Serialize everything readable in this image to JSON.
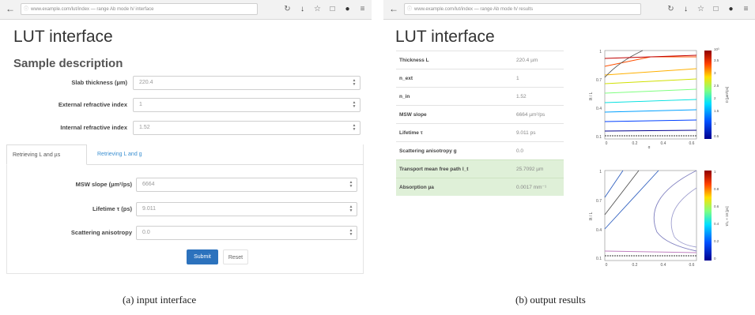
{
  "panel_a": {
    "url_text": "www.example.com/lut/index — range Ab mode h/ interface",
    "title": "LUT interface",
    "section_title": "Sample description",
    "fields": [
      {
        "label": "Slab thickness (µm)",
        "value": "220.4"
      },
      {
        "label": "External refractive index",
        "value": "1"
      },
      {
        "label": "Internal refractive index",
        "value": "1.52"
      }
    ],
    "tabs": [
      {
        "label": "Retrieving L and µs",
        "active": true
      },
      {
        "label": "Retrieving L and g",
        "active": false
      }
    ],
    "tab_fields": [
      {
        "label": "MSW slope (µm²/ps)",
        "value": "6664"
      },
      {
        "label": "Lifetime τ (ps)",
        "value": "9.011"
      },
      {
        "label": "Scattering anisotropy",
        "value": "0.0"
      }
    ],
    "submit_label": "Submit",
    "reset_label": "Reset",
    "caption": "(a) input interface"
  },
  "panel_b": {
    "url_text": "www.example.com/lut/index — range Ab mode h/ results",
    "title": "LUT interface",
    "rows": [
      {
        "label": "Thickness L",
        "value": "220.4 µm",
        "highlight": false
      },
      {
        "label": "n_ext",
        "value": "1",
        "highlight": false
      },
      {
        "label": "n_in",
        "value": "1.52",
        "highlight": false
      },
      {
        "label": "MSW slope",
        "value": "6664 µm²/ps",
        "highlight": false
      },
      {
        "label": "Lifetime τ",
        "value": "9.011 ps",
        "highlight": false
      },
      {
        "label": "Scattering anisotropy g",
        "value": "0.0",
        "highlight": false
      },
      {
        "label": "Transport mean free path l_t",
        "value": "25.7092 µm",
        "highlight": true
      },
      {
        "label": "Absorption µa",
        "value": "0.0017 mm⁻¹",
        "highlight": true
      }
    ],
    "plots": {
      "top": {
        "y_ticks": [
          "1",
          "0.7",
          "0.4",
          "0.1"
        ],
        "x_ticks": [
          "0",
          "0.2",
          "0.4",
          "0.6"
        ],
        "xlabel": "g",
        "ylabel": "l/t / L",
        "cbar_ticks": [
          "10³",
          "3.5",
          "3",
          "2.5",
          "2",
          "1.5",
          "1",
          "0.5"
        ],
        "cbar_label": "D [µm²/ps]"
      },
      "bottom": {
        "y_ticks": [
          "1",
          "0.7",
          "0.4",
          "0.1"
        ],
        "x_ticks": [
          "0",
          "0.2",
          "0.4",
          "0.6"
        ],
        "ylabel": "l/t / L",
        "cbar_ticks": [
          "1",
          "0.8",
          "0.6",
          "0.4",
          "0.2",
          "0"
        ],
        "cbar_label": "τ/τ₀ × 10 [ps]"
      }
    },
    "caption": "(b) output results"
  }
}
